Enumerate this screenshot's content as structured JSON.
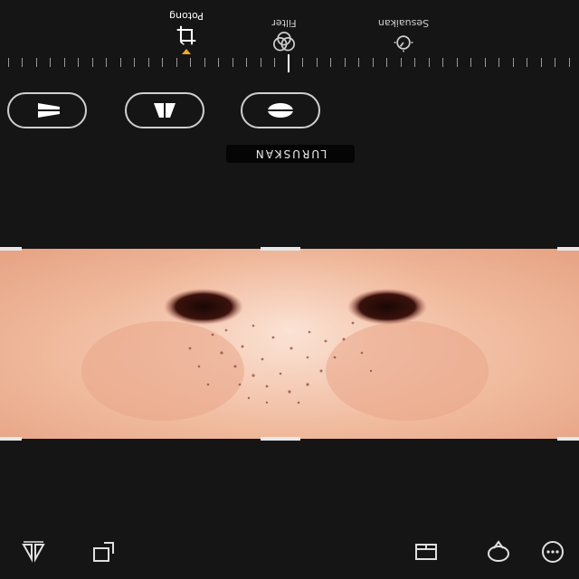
{
  "editor": {
    "straighten_label": "LURUSKAN",
    "tabs": [
      {
        "label": "Potong",
        "icon": "crop-rotate-icon",
        "active": true
      },
      {
        "label": "Filter",
        "icon": "filter-icon",
        "active": false
      },
      {
        "label": "Sesuaikan",
        "icon": "adjust-icon",
        "active": false
      }
    ],
    "accent_color": "#f5a623",
    "bottom_toolbar_icons": [
      "flip-icon",
      "rotate-icon",
      "aspect-ratio-icon",
      "lasso-icon",
      "more-icon"
    ],
    "transform_buttons": [
      "flip-horizontal-icon",
      "perspective-vertical-icon",
      "perspective-horizontal-icon"
    ]
  }
}
